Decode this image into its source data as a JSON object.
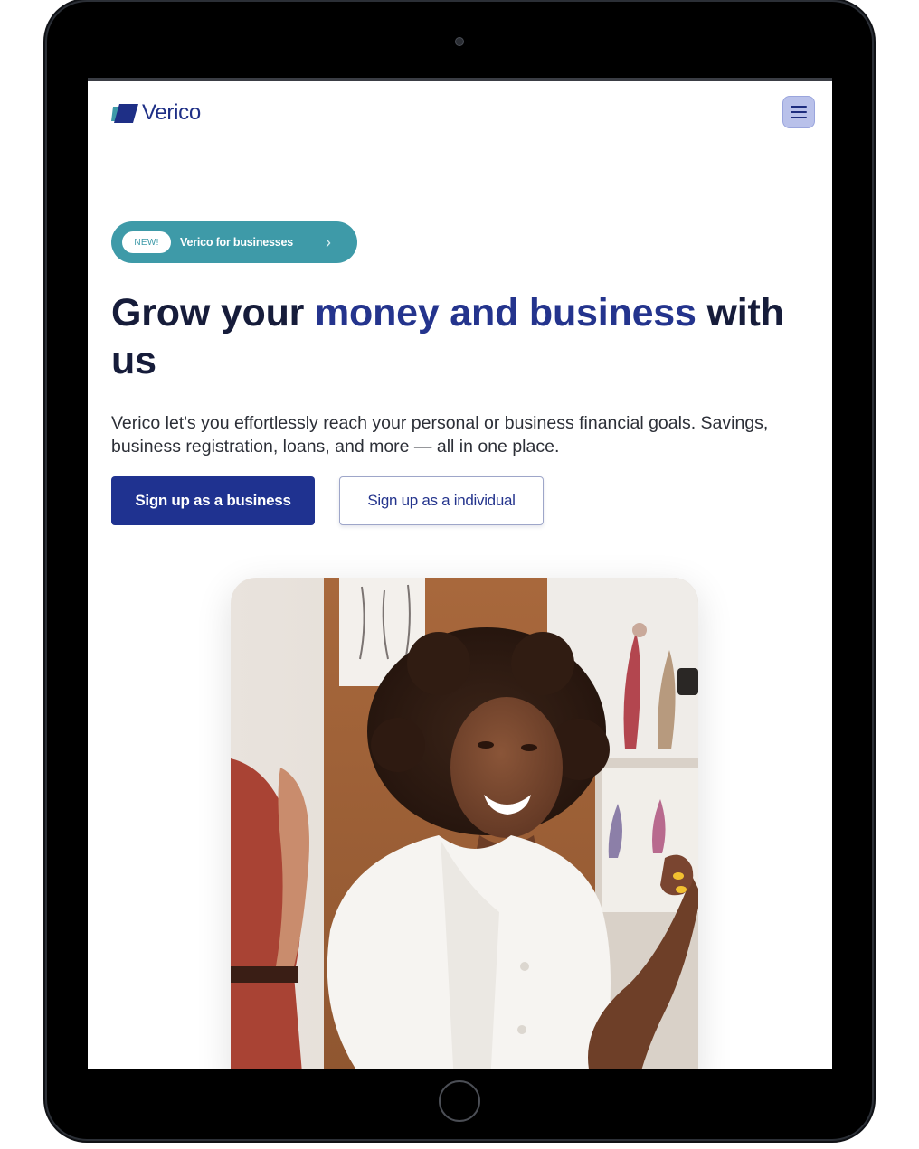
{
  "brand": {
    "name": "Verico",
    "color": "#1e2f86"
  },
  "nav": {
    "menu_icon": "hamburger-menu-icon"
  },
  "badge": {
    "tag": "NEW!",
    "label": "Verico for businesses",
    "chevron": "›",
    "color": "#3e9aa8"
  },
  "hero": {
    "headline_part1": "Grow your ",
    "headline_accent": "money and business",
    "headline_part2": " with us",
    "description": "Verico let's you effortlessly reach your personal or business financial goals. Savings, business registration, loans, and more — all in one place.",
    "primary_cta": "Sign up as a business",
    "secondary_cta": "Sign up as a individual",
    "accent_color": "#24348d",
    "primary_color": "#1f3290"
  },
  "hero_image": {
    "subject": "smiling-woman-photo"
  }
}
